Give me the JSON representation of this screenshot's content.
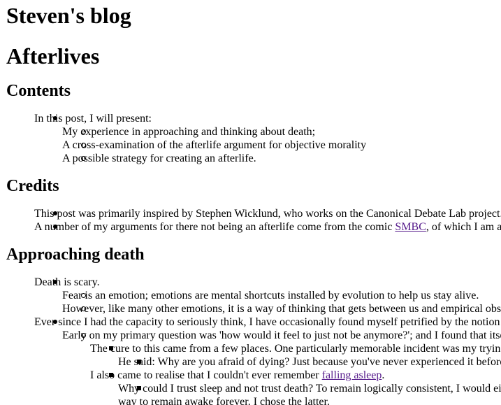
{
  "site": {
    "title": "Steven's blog"
  },
  "post": {
    "title": "Afterlives"
  },
  "contents": {
    "heading": "Contents",
    "intro": "In this post, I will present:",
    "items": [
      "My experience in approaching and thinking about death;",
      "A cross-examination of the afterlife argument for objective morality",
      "A possible strategy for creating an afterlife."
    ]
  },
  "credits": {
    "heading": "Credits",
    "item1": "This post was primarily inspired by Stephen Wicklund, who works on the Canonical Debate Lab project.",
    "item2_before": "A number of my arguments for there not being an afterlife come from the comic ",
    "item2_link": "SMBC",
    "item2_after": ", of which I am a"
  },
  "approaching": {
    "heading": "Approaching death",
    "death_scary": "Death is scary.",
    "fear": "Fear is an emotion; emotions are mental shortcuts installed by evolution to help us stay alive.",
    "however": "However, like many other emotions, it is a way of thinking that gets between us and empirical obs",
    "ever_since": "Ever since I had the capacity to seriously think, I have occasionally found myself petrified by the notion",
    "early_on": "Early on my primary question was 'how would it feel to just not be anymore?'; and I found that itse",
    "cure": "The cure to this came from a few places. One particularly memorable incident was my tryin",
    "he_said": "He said: Why are you afraid of dying? Just because you've never experienced it before",
    "realise_before": "I also came to realise that I couldn't ever remember ",
    "realise_link": "falling asleep",
    "realise_after": ".",
    "why_could": "Why could I trust sleep and not trust death? To remain logically consistent, I would ei",
    "why_could_cont": "way to remain awake forever. I chose the latter."
  }
}
